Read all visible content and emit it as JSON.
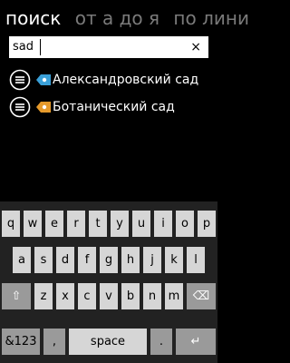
{
  "pivot": {
    "tabs": [
      {
        "label": "поиск",
        "active": true
      },
      {
        "label": "от а до я",
        "active": false
      },
      {
        "label": "по лини",
        "active": false
      }
    ]
  },
  "search": {
    "value": "sad",
    "clear_icon": "×"
  },
  "results": [
    {
      "label": "Александровский сад",
      "line_color": "#3aa0d8",
      "icon": "list-icon"
    },
    {
      "label": "Ботанический сад",
      "line_color": "#e69a2b",
      "icon": "list-icon"
    }
  ],
  "keyboard": {
    "row1": [
      "q",
      "w",
      "e",
      "r",
      "t",
      "y",
      "u",
      "i",
      "o",
      "p"
    ],
    "row2": [
      "a",
      "s",
      "d",
      "f",
      "g",
      "h",
      "j",
      "k",
      "l"
    ],
    "row3": [
      "z",
      "x",
      "c",
      "v",
      "b",
      "n",
      "m"
    ],
    "shift_icon": "⇧",
    "backspace_icon": "⌫",
    "numbers_label": "&123",
    "comma_label": ",",
    "space_label": "space",
    "period_label": ".",
    "enter_icon": "↵"
  }
}
